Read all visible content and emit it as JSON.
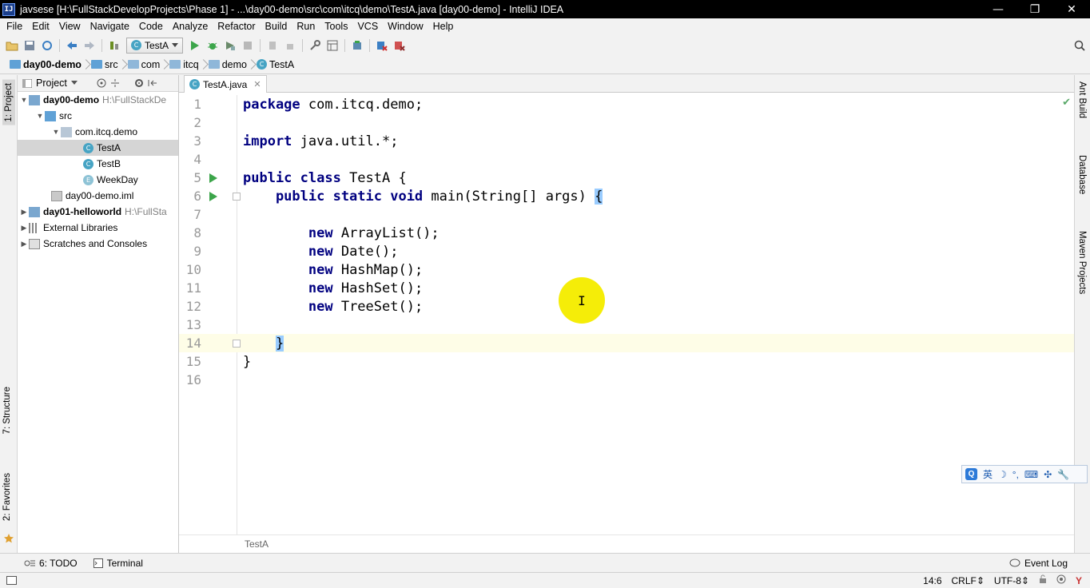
{
  "window": {
    "app_icon": "IJ",
    "title": "javsese [H:\\FullStackDevelopProjects\\Phase 1] - ...\\day00-demo\\src\\com\\itcq\\demo\\TestA.java [day00-demo] - IntelliJ IDEA",
    "minimize": "—",
    "restore": "❐",
    "close": "✕"
  },
  "menu": [
    "File",
    "Edit",
    "View",
    "Navigate",
    "Code",
    "Analyze",
    "Refactor",
    "Build",
    "Run",
    "Tools",
    "VCS",
    "Window",
    "Help"
  ],
  "toolbar": {
    "run_config": "TestA"
  },
  "breadcrumb": [
    "day00-demo",
    "src",
    "com",
    "itcq",
    "demo",
    "TestA"
  ],
  "left_stripe": {
    "project": "1: Project",
    "structure": "7: Structure",
    "favorites": "2: Favorites"
  },
  "right_stripe": {
    "ant": "Ant Build",
    "database": "Database",
    "maven": "Maven Projects"
  },
  "project_panel": {
    "header": "Project",
    "tree": [
      {
        "label": "day00-demo",
        "path": "H:\\FullStackDe"
      },
      {
        "label": "src"
      },
      {
        "label": "com.itcq.demo"
      },
      {
        "label": "TestA",
        "icon": "C"
      },
      {
        "label": "TestB",
        "icon": "C"
      },
      {
        "label": "WeekDay",
        "icon": "E"
      },
      {
        "label": "day00-demo.iml"
      },
      {
        "label": "day01-helloworld",
        "path": "H:\\FullSta"
      },
      {
        "label": "External Libraries"
      },
      {
        "label": "Scratches and Consoles"
      }
    ]
  },
  "editor": {
    "tab_label": "TestA.java",
    "tab_icon": "C",
    "footer_breadcrumb": "TestA",
    "lines": [
      {
        "n": "1",
        "kw": "package",
        "rest": " com.itcq.demo;"
      },
      {
        "n": "2",
        "kw": "",
        "rest": ""
      },
      {
        "n": "3",
        "kw": "import",
        "rest": " java.util.*;"
      },
      {
        "n": "4",
        "kw": "",
        "rest": ""
      },
      {
        "n": "5",
        "kw": "public class",
        "rest": " TestA {"
      },
      {
        "n": "6",
        "kw": "    public static void",
        "rest": " main(String[] args) ",
        "brace": "{"
      },
      {
        "n": "7",
        "kw": "",
        "rest": ""
      },
      {
        "n": "8",
        "kw": "        new",
        "rest": " ArrayList();"
      },
      {
        "n": "9",
        "kw": "        new",
        "rest": " Date();"
      },
      {
        "n": "10",
        "kw": "        new",
        "rest": " HashMap();"
      },
      {
        "n": "11",
        "kw": "        new",
        "rest": " HashSet();"
      },
      {
        "n": "12",
        "kw": "        new",
        "rest": " TreeSet();"
      },
      {
        "n": "13",
        "kw": "",
        "rest": ""
      },
      {
        "n": "14",
        "kw": "    ",
        "rest": "",
        "brace": "}"
      },
      {
        "n": "15",
        "kw": "",
        "rest": "}"
      },
      {
        "n": "16",
        "kw": "",
        "rest": ""
      }
    ],
    "cursor_glyph": "I"
  },
  "ime": {
    "q": "Q",
    "lang": "英",
    "moon": "☽",
    "punct": "°,",
    "kbd": "⌨",
    "fullwidth": "✣",
    "settings": "🔧"
  },
  "bottom_tabs": {
    "todo": "6: TODO",
    "terminal": "Terminal",
    "event_log": "Event Log"
  },
  "status": {
    "position": "14:6",
    "line_sep": "CRLF",
    "encoding": "UTF-8"
  },
  "colors": {
    "keyword": "#000080",
    "run_icon": "#3ca54a",
    "class_icon": "#47a4c4",
    "current_line": "#fefde7",
    "brace_highlight": "#99ccff"
  }
}
